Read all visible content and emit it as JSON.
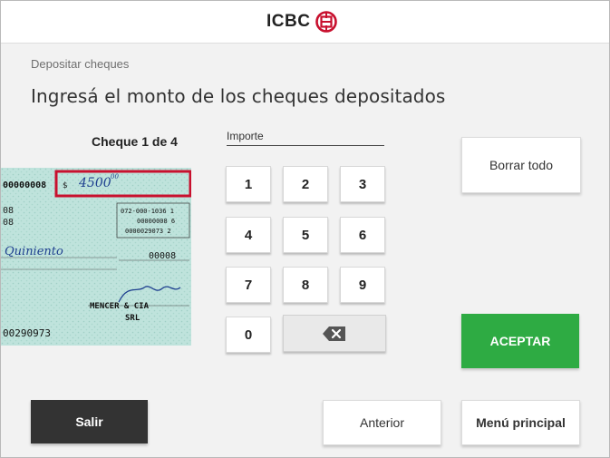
{
  "brand": {
    "name": "ICBC",
    "accent": "#c8102e"
  },
  "breadcrumb": "Depositar cheques",
  "title": "Ingresá el monto de los cheques depositados",
  "cheque": {
    "counter": "Cheque 1 de 4",
    "amount_handwritten": "4500",
    "amount_suffix": "00",
    "currency_symbol": "$",
    "account_number": "00000008",
    "routing_lines": [
      "072-000-1036 1",
      "00000008 6",
      "0000029073 2"
    ],
    "bank_code": "00008",
    "amount_words": "Quiniento",
    "signature_company": "MENCER & CIA",
    "signature_type": "SRL",
    "micr_fragment": "00290973",
    "side_numbers": [
      "08",
      "08"
    ]
  },
  "amount_field": {
    "label": "Importe",
    "value": ""
  },
  "keypad": {
    "keys": [
      "1",
      "2",
      "3",
      "4",
      "5",
      "6",
      "7",
      "8",
      "9",
      "0"
    ],
    "backspace_icon": "backspace-icon"
  },
  "actions": {
    "clear_all": "Borrar todo",
    "accept": "ACEPTAR",
    "exit": "Salir",
    "previous": "Anterior",
    "main_menu": "Menú principal"
  },
  "colors": {
    "accept": "#2eab43",
    "exit": "#333333",
    "highlight_box": "#c8102e"
  }
}
